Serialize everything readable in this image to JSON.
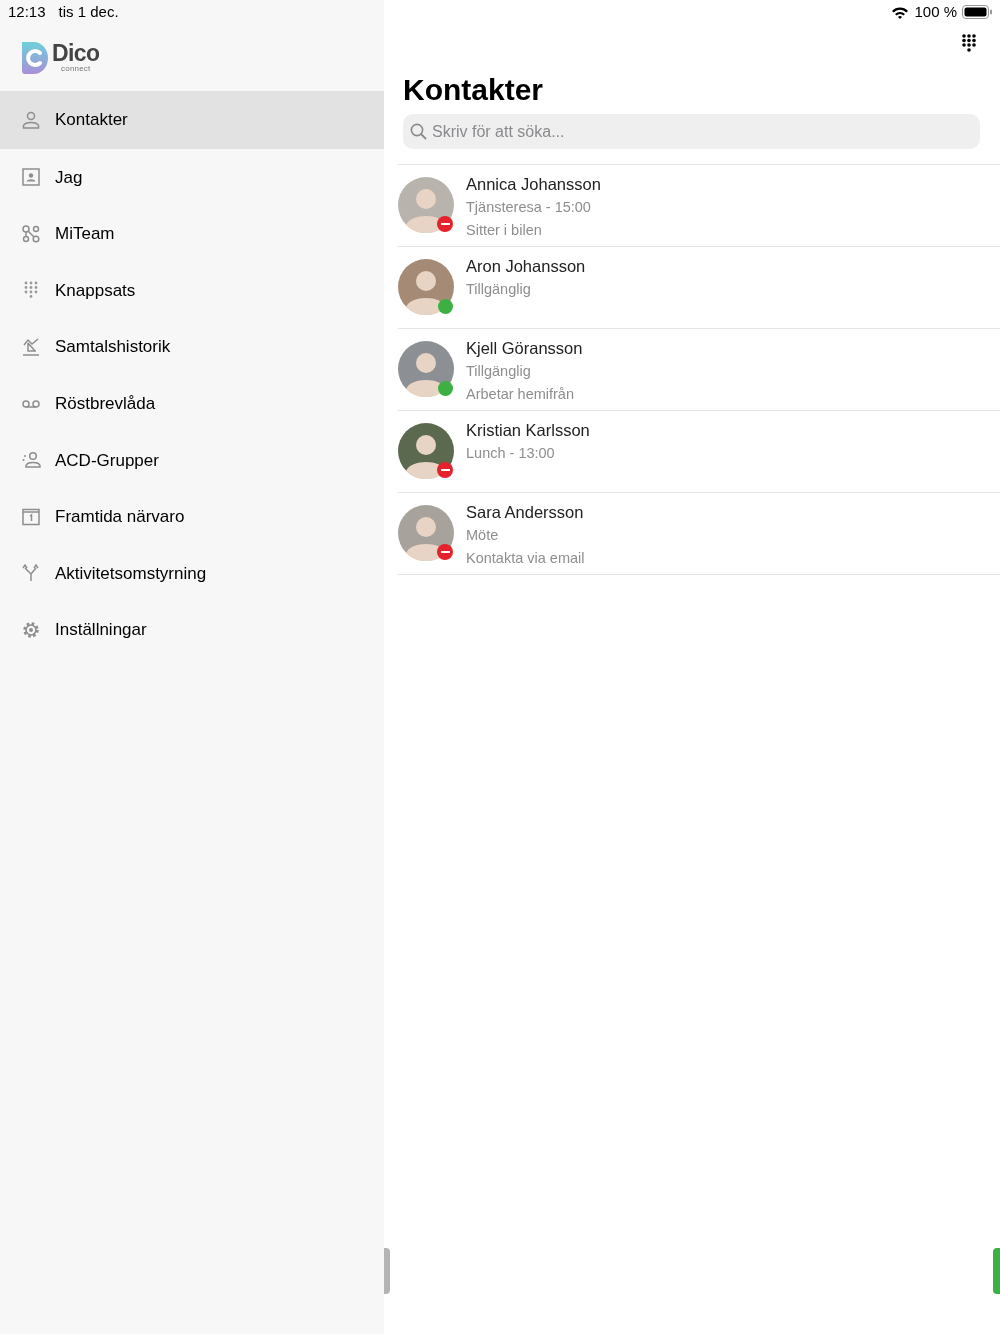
{
  "status_bar": {
    "time": "12:13",
    "date": "tis 1 dec.",
    "battery": "100 %"
  },
  "sidebar": {
    "logo": {
      "name": "Dico",
      "tagline": "connect"
    },
    "items": [
      {
        "label": "Kontakter",
        "selected": true
      },
      {
        "label": "Jag",
        "selected": false
      },
      {
        "label": "MiTeam",
        "selected": false
      },
      {
        "label": "Knappsats",
        "selected": false
      },
      {
        "label": "Samtalshistorik",
        "selected": false
      },
      {
        "label": "Röstbrevlåda",
        "selected": false
      },
      {
        "label": "ACD-Grupper",
        "selected": false
      },
      {
        "label": "Framtida närvaro",
        "selected": false
      },
      {
        "label": "Aktivitetsomstyrning",
        "selected": false
      },
      {
        "label": "Inställningar",
        "selected": false
      }
    ]
  },
  "main": {
    "title": "Kontakter",
    "search": {
      "placeholder": "Skriv för att söka..."
    },
    "contacts": [
      {
        "name": "Annica Johansson",
        "kind": "busy",
        "lines": [
          "Tjänsteresa - 15:00",
          "Sitter i bilen"
        ]
      },
      {
        "name": "Aron Johansson",
        "kind": "available",
        "lines": [
          "Tillgänglig"
        ]
      },
      {
        "name": "Kjell Göransson",
        "kind": "available",
        "lines": [
          "Tillgänglig",
          "Arbetar hemifrån"
        ]
      },
      {
        "name": "Kristian Karlsson",
        "kind": "busy",
        "lines": [
          "Lunch - 13:00"
        ]
      },
      {
        "name": "Sara Andersson",
        "kind": "busy",
        "lines": [
          "Möte",
          "Kontakta via email"
        ]
      }
    ]
  }
}
